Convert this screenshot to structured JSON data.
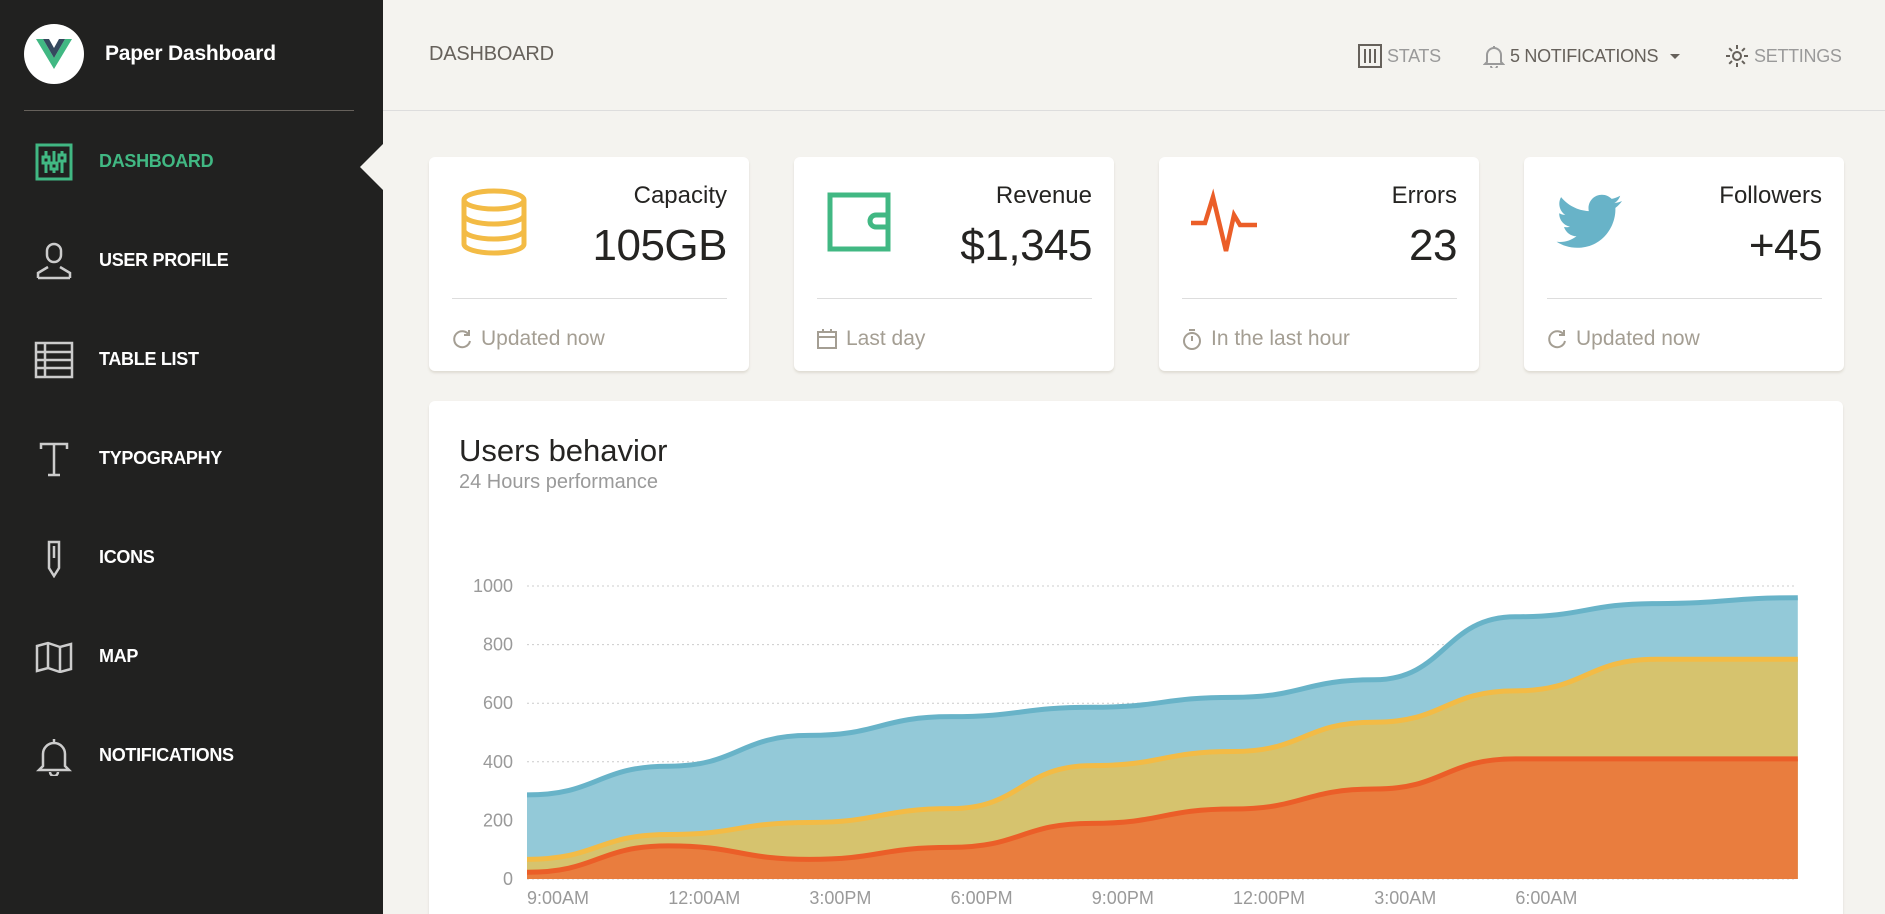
{
  "sidebar": {
    "brand": "Paper Dashboard",
    "items": [
      {
        "label": "DASHBOARD",
        "icon": "sliders-icon",
        "active": true
      },
      {
        "label": "USER PROFILE",
        "icon": "user-icon"
      },
      {
        "label": "TABLE LIST",
        "icon": "table-list-icon"
      },
      {
        "label": "TYPOGRAPHY",
        "icon": "typography-icon"
      },
      {
        "label": "ICONS",
        "icon": "pencil-icon"
      },
      {
        "label": "MAP",
        "icon": "map-icon"
      },
      {
        "label": "NOTIFICATIONS",
        "icon": "bell-icon"
      }
    ]
  },
  "topbar": {
    "title": "DASHBOARD",
    "stats": "STATS",
    "notifications": "5 NOTIFICATIONS",
    "settings": "SETTINGS"
  },
  "stats": [
    {
      "label": "Capacity",
      "value": "105GB",
      "footer": "Updated now",
      "icon": "database-icon",
      "footer_icon": "reload-icon",
      "color": "#f3bb45"
    },
    {
      "label": "Revenue",
      "value": "$1,345",
      "footer": "Last day",
      "icon": "wallet-icon",
      "footer_icon": "calendar-icon",
      "color": "#41b883"
    },
    {
      "label": "Errors",
      "value": "23",
      "footer": "In the last hour",
      "icon": "pulse-icon",
      "footer_icon": "timer-icon",
      "color": "#eb5e28"
    },
    {
      "label": "Followers",
      "value": "+45",
      "footer": "Updated now",
      "icon": "twitter-icon",
      "footer_icon": "reload-icon",
      "color": "#68b3c8"
    }
  ],
  "chart": {
    "title": "Users behavior",
    "subtitle": "24 Hours performance"
  },
  "chart_data": {
    "type": "area",
    "x": [
      "9:00AM",
      "12:00AM",
      "3:00PM",
      "6:00PM",
      "9:00PM",
      "12:00PM",
      "3:00AM",
      "6:00AM",
      "",
      ""
    ],
    "xlabels": [
      "9:00AM",
      "12:00AM",
      "3:00PM",
      "6:00PM",
      "9:00PM",
      "12:00PM",
      "3:00AM",
      "6:00AM"
    ],
    "ylim": [
      0,
      1000
    ],
    "yticks": [
      0,
      200,
      400,
      600,
      800,
      1000
    ],
    "grid": true,
    "series": [
      {
        "values": [
          287,
          385,
          490,
          554,
          586,
          620,
          680,
          895,
          940,
          960
        ],
        "color": "#68b3c8",
        "fill": "#93c9d8"
      },
      {
        "values": [
          67,
          152,
          193,
          240,
          387,
          435,
          535,
          642,
          750,
          750
        ],
        "color": "#f3bb45",
        "fill": "#d6c36e"
      },
      {
        "values": [
          23,
          113,
          67,
          108,
          190,
          239,
          307,
          410,
          410,
          410
        ],
        "color": "#eb5e28",
        "fill": "#e97d3e"
      }
    ]
  }
}
